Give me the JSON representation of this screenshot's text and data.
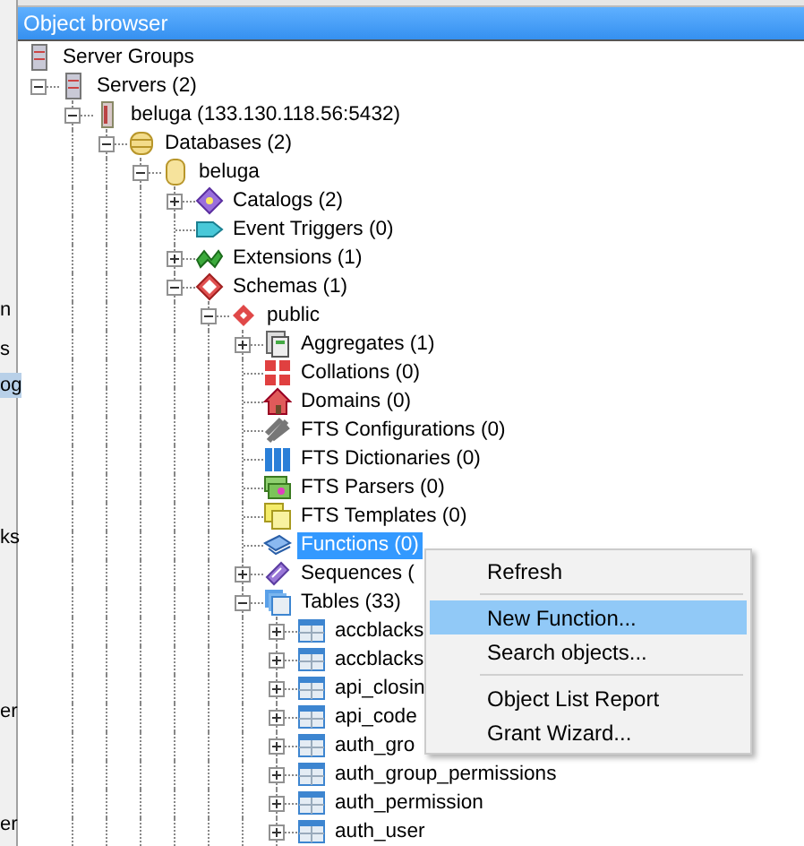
{
  "background_window": {
    "fragments": [
      {
        "text": "n",
        "selected": false
      },
      {
        "text": "s",
        "selected": false
      },
      {
        "text": "og",
        "selected": true
      },
      {
        "text": "ks",
        "selected": false
      },
      {
        "text": "er",
        "selected": false
      },
      {
        "text": "er",
        "selected": false
      }
    ]
  },
  "panel": {
    "title": "Object browser"
  },
  "tree": [
    {
      "label": "Server Groups",
      "kind": "server-group",
      "selected": false,
      "children": [
        {
          "label": "Servers (2)",
          "kind": "server-group",
          "leaf": false,
          "expanded": true,
          "selected": false,
          "children": [
            {
              "label": "beluga (133.130.118.56:5432)",
              "kind": "server",
              "leaf": false,
              "expanded": true,
              "selected": false,
              "children": [
                {
                  "label": "Databases (2)",
                  "kind": "database-group",
                  "leaf": false,
                  "expanded": true,
                  "selected": false,
                  "children": [
                    {
                      "label": "beluga",
                      "kind": "database",
                      "leaf": false,
                      "expanded": true,
                      "selected": false,
                      "children": [
                        {
                          "label": "Catalogs (2)",
                          "kind": "catalog",
                          "leaf": false,
                          "expanded": false,
                          "selected": false
                        },
                        {
                          "label": "Event Triggers (0)",
                          "kind": "trigger",
                          "leaf": true,
                          "expanded": false,
                          "selected": false
                        },
                        {
                          "label": "Extensions (1)",
                          "kind": "extension",
                          "leaf": false,
                          "expanded": false,
                          "selected": false
                        },
                        {
                          "label": "Schemas (1)",
                          "kind": "schema-group",
                          "leaf": false,
                          "expanded": true,
                          "selected": false,
                          "children": [
                            {
                              "label": "public",
                              "kind": "schema",
                              "leaf": false,
                              "expanded": true,
                              "selected": false,
                              "children": [
                                {
                                  "label": "Aggregates (1)",
                                  "kind": "aggregate",
                                  "leaf": false,
                                  "expanded": false,
                                  "selected": false
                                },
                                {
                                  "label": "Collations (0)",
                                  "kind": "collation",
                                  "leaf": true,
                                  "expanded": false,
                                  "selected": false
                                },
                                {
                                  "label": "Domains (0)",
                                  "kind": "domain",
                                  "leaf": true,
                                  "expanded": false,
                                  "selected": false
                                },
                                {
                                  "label": "FTS Configurations (0)",
                                  "kind": "fts-config",
                                  "leaf": true,
                                  "expanded": false,
                                  "selected": false
                                },
                                {
                                  "label": "FTS Dictionaries (0)",
                                  "kind": "fts-dict",
                                  "leaf": true,
                                  "expanded": false,
                                  "selected": false
                                },
                                {
                                  "label": "FTS Parsers (0)",
                                  "kind": "fts-parser",
                                  "leaf": true,
                                  "expanded": false,
                                  "selected": false
                                },
                                {
                                  "label": "FTS Templates (0)",
                                  "kind": "fts-template",
                                  "leaf": true,
                                  "expanded": false,
                                  "selected": false
                                },
                                {
                                  "label": "Functions (0)",
                                  "kind": "function",
                                  "leaf": true,
                                  "expanded": false,
                                  "selected": true
                                },
                                {
                                  "label": "Sequences (",
                                  "kind": "sequence",
                                  "leaf": false,
                                  "expanded": false,
                                  "selected": false
                                },
                                {
                                  "label": "Tables (33)",
                                  "kind": "table-group",
                                  "leaf": false,
                                  "expanded": true,
                                  "selected": false,
                                  "children": [
                                    {
                                      "label": "accblacks",
                                      "kind": "table",
                                      "leaf": false,
                                      "expanded": false,
                                      "selected": false
                                    },
                                    {
                                      "label": "accblacks",
                                      "kind": "table",
                                      "leaf": false,
                                      "expanded": false,
                                      "selected": false
                                    },
                                    {
                                      "label": "api_closin",
                                      "kind": "table",
                                      "leaf": false,
                                      "expanded": false,
                                      "selected": false
                                    },
                                    {
                                      "label": "api_code",
                                      "kind": "table",
                                      "leaf": false,
                                      "expanded": false,
                                      "selected": false
                                    },
                                    {
                                      "label": "auth_gro",
                                      "kind": "table",
                                      "leaf": false,
                                      "expanded": false,
                                      "selected": false
                                    },
                                    {
                                      "label": "auth_group_permissions",
                                      "kind": "table",
                                      "leaf": false,
                                      "expanded": false,
                                      "selected": false
                                    },
                                    {
                                      "label": "auth_permission",
                                      "kind": "table",
                                      "leaf": false,
                                      "expanded": false,
                                      "selected": false
                                    },
                                    {
                                      "label": "auth_user",
                                      "kind": "table",
                                      "leaf": false,
                                      "expanded": false,
                                      "selected": false
                                    }
                                  ]
                                }
                              ]
                            }
                          ]
                        }
                      ]
                    }
                  ]
                }
              ]
            }
          ]
        }
      ]
    }
  ],
  "context_menu": [
    {
      "kind": "item",
      "label": "Refresh",
      "selected": false
    },
    {
      "kind": "separator"
    },
    {
      "kind": "item",
      "label": "New Function...",
      "selected": true
    },
    {
      "kind": "item",
      "label": "Search objects...",
      "selected": false
    },
    {
      "kind": "separator"
    },
    {
      "kind": "item",
      "label": "Object List Report",
      "selected": false
    },
    {
      "kind": "item",
      "label": "Grant Wizard...",
      "selected": false
    }
  ]
}
